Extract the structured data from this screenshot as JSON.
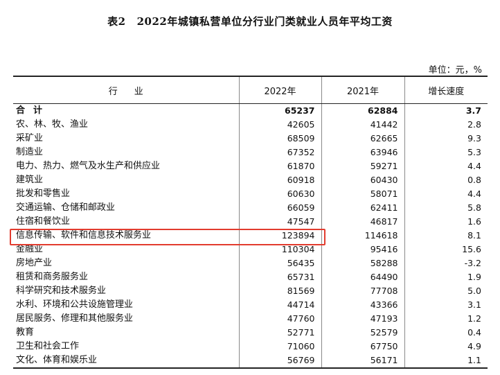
{
  "title": {
    "table_no": "表2",
    "text": "2022年城镇私营单位分行业门类就业人员年平均工资"
  },
  "unit": "单位：元，%",
  "headers": [
    "行业",
    "2022年",
    "2021年",
    "增长速度"
  ],
  "highlight_color": "#e23b2e",
  "rows": [
    {
      "name": "合计",
      "y2022": "65237",
      "y2021": "62884",
      "growth": "3.7"
    },
    {
      "name": "农、林、牧、渔业",
      "y2022": "42605",
      "y2021": "41442",
      "growth": "2.8"
    },
    {
      "name": "采矿业",
      "y2022": "68509",
      "y2021": "62665",
      "growth": "9.3"
    },
    {
      "name": "制造业",
      "y2022": "67352",
      "y2021": "63946",
      "growth": "5.3"
    },
    {
      "name": "电力、热力、燃气及水生产和供应业",
      "y2022": "61870",
      "y2021": "59271",
      "growth": "4.4"
    },
    {
      "name": "建筑业",
      "y2022": "60918",
      "y2021": "60430",
      "growth": "0.8"
    },
    {
      "name": "批发和零售业",
      "y2022": "60630",
      "y2021": "58071",
      "growth": "4.4"
    },
    {
      "name": "交通运输、仓储和邮政业",
      "y2022": "66059",
      "y2021": "62411",
      "growth": "5.8"
    },
    {
      "name": "住宿和餐饮业",
      "y2022": "47547",
      "y2021": "46817",
      "growth": "1.6"
    },
    {
      "name": "信息传输、软件和信息技术服务业",
      "y2022": "123894",
      "y2021": "114618",
      "growth": "8.1"
    },
    {
      "name": "金融业",
      "y2022": "110304",
      "y2021": "95416",
      "growth": "15.6"
    },
    {
      "name": "房地产业",
      "y2022": "56435",
      "y2021": "58288",
      "growth": "-3.2"
    },
    {
      "name": "租赁和商务服务业",
      "y2022": "65731",
      "y2021": "64490",
      "growth": "1.9"
    },
    {
      "name": "科学研究和技术服务业",
      "y2022": "81569",
      "y2021": "77708",
      "growth": "5.0"
    },
    {
      "name": "水利、环境和公共设施管理业",
      "y2022": "44714",
      "y2021": "43366",
      "growth": "3.1"
    },
    {
      "name": "居民服务、修理和其他服务业",
      "y2022": "47760",
      "y2021": "47193",
      "growth": "1.2"
    },
    {
      "name": "教育",
      "y2022": "52771",
      "y2021": "52579",
      "growth": "0.4"
    },
    {
      "name": "卫生和社会工作",
      "y2022": "71060",
      "y2021": "67750",
      "growth": "4.9"
    },
    {
      "name": "文化、体育和娱乐业",
      "y2022": "56769",
      "y2021": "56171",
      "growth": "1.1"
    }
  ]
}
